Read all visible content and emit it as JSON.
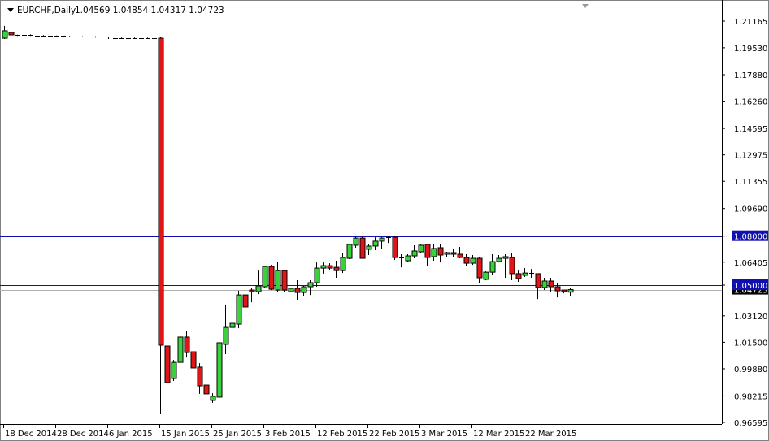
{
  "header": {
    "symbol": "EURCHF,Daily",
    "ohlc": "1.04569 1.04854 1.04317 1.04723"
  },
  "colors": {
    "bull": "#3ad23a",
    "bear": "#e01515",
    "hline": "#1010b0",
    "price_line": "#b0b0b0"
  },
  "chart_data": {
    "type": "candlestick",
    "title": "EURCHF,Daily",
    "ylim": [
      0.96595,
      1.21165
    ],
    "y_ticks": [
      "1.21165",
      "1.19530",
      "1.17880",
      "1.16260",
      "1.14595",
      "1.12975",
      "1.11355",
      "1.09690",
      "1.08000",
      "1.06405",
      "1.05000",
      "1.03120",
      "1.01500",
      "0.99880",
      "0.98215",
      "0.96595"
    ],
    "x_ticks": [
      {
        "index": 0,
        "label": "18 Dec 2014"
      },
      {
        "index": 8,
        "label": "28 Dec 2014"
      },
      {
        "index": 16,
        "label": "6 Jan 2015"
      },
      {
        "index": 24,
        "label": "15 Jan 2015"
      },
      {
        "index": 32,
        "label": "25 Jan 2015"
      },
      {
        "index": 40,
        "label": "3 Feb 2015"
      },
      {
        "index": 48,
        "label": "12 Feb 2015"
      },
      {
        "index": 56,
        "label": "22 Feb 2015"
      },
      {
        "index": 64,
        "label": "3 Mar 2015"
      },
      {
        "index": 72,
        "label": "12 Mar 2015"
      },
      {
        "index": 80,
        "label": "22 Mar 2015"
      }
    ],
    "horizontal_lines": [
      {
        "value": 1.08,
        "label": "1.08000"
      },
      {
        "value": 1.05,
        "label": "1.05000"
      }
    ],
    "last_price": {
      "value": 1.04723,
      "label": "1.04723"
    },
    "ohlc": [
      [
        1.2012,
        1.2087,
        1.2007,
        1.2057
      ],
      [
        1.2047,
        1.2047,
        1.2027,
        1.2032
      ],
      [
        1.203,
        1.2033,
        1.2026,
        1.2029
      ],
      [
        1.2029,
        1.2033,
        1.2025,
        1.203
      ],
      [
        1.203,
        1.2035,
        1.2026,
        1.2028
      ],
      [
        1.2028,
        1.203,
        1.2024,
        1.2027
      ],
      [
        1.2027,
        1.2031,
        1.2023,
        1.2026
      ],
      [
        1.2026,
        1.2028,
        1.2022,
        1.2024
      ],
      [
        1.2024,
        1.2028,
        1.2021,
        1.2025
      ],
      [
        1.2025,
        1.2029,
        1.202,
        1.2023
      ],
      [
        1.2023,
        1.2026,
        1.2019,
        1.2022
      ],
      [
        1.2022,
        1.2025,
        1.2018,
        1.2021
      ],
      [
        1.2021,
        1.2024,
        1.2018,
        1.202
      ],
      [
        1.202,
        1.2023,
        1.2017,
        1.2019
      ],
      [
        1.2019,
        1.2024,
        1.2016,
        1.2021
      ],
      [
        1.2021,
        1.2025,
        1.2017,
        1.202
      ],
      [
        1.202,
        1.2022,
        1.2007,
        1.2012
      ],
      [
        1.2013,
        1.2016,
        1.201,
        1.2014
      ],
      [
        1.2014,
        1.2016,
        1.2011,
        1.2013
      ],
      [
        1.2013,
        1.2016,
        1.201,
        1.2014
      ],
      [
        1.2014,
        1.2016,
        1.2011,
        1.2013
      ],
      [
        1.2013,
        1.2015,
        1.201,
        1.2012
      ],
      [
        1.2012,
        1.2015,
        1.201,
        1.2013
      ],
      [
        1.2013,
        1.2015,
        1.201,
        1.2012
      ],
      [
        1.2012,
        1.2017,
        0.9709,
        1.0132
      ],
      [
        1.0127,
        1.0246,
        0.9744,
        0.9903
      ],
      [
        0.9928,
        1.0042,
        0.9913,
        1.0027
      ],
      [
        1.0027,
        1.0211,
        0.9858,
        1.0182
      ],
      [
        1.0182,
        1.0221,
        1.0057,
        1.0087
      ],
      [
        1.0092,
        1.0132,
        0.9843,
        0.9993
      ],
      [
        0.9998,
        1.0022,
        0.9834,
        0.9883
      ],
      [
        0.9888,
        0.9913,
        0.9774,
        0.9834
      ],
      [
        0.9794,
        0.9838,
        0.9779,
        0.9819
      ],
      [
        0.9814,
        1.0167,
        0.9814,
        1.0147
      ],
      [
        1.0137,
        1.0381,
        1.0077,
        1.0241
      ],
      [
        1.0241,
        1.0316,
        1.0177,
        1.0266
      ],
      [
        1.0261,
        1.0465,
        1.0236,
        1.044
      ],
      [
        1.044,
        1.052,
        1.0346,
        1.0366
      ],
      [
        1.047,
        1.048,
        1.0395,
        1.046
      ],
      [
        1.046,
        1.0589,
        1.0445,
        1.0495
      ],
      [
        1.049,
        1.0619,
        1.048,
        1.0614
      ],
      [
        1.0614,
        1.0624,
        1.047,
        1.0475
      ],
      [
        1.047,
        1.0644,
        1.0455,
        1.0589
      ],
      [
        1.0589,
        1.0594,
        1.0455,
        1.047
      ],
      [
        1.046,
        1.0485,
        1.0455,
        1.048
      ],
      [
        1.048,
        1.053,
        1.041,
        1.0455
      ],
      [
        1.0455,
        1.0495,
        1.0435,
        1.049
      ],
      [
        1.049,
        1.053,
        1.044,
        1.0515
      ],
      [
        1.0515,
        1.0639,
        1.049,
        1.0604
      ],
      [
        1.0604,
        1.0639,
        1.057,
        1.0619
      ],
      [
        1.0619,
        1.0634,
        1.0594,
        1.0604
      ],
      [
        1.0609,
        1.0649,
        1.0545,
        1.0589
      ],
      [
        1.0589,
        1.0694,
        1.0574,
        1.0669
      ],
      [
        1.0664,
        1.0754,
        1.0659,
        1.0749
      ],
      [
        1.0744,
        1.0803,
        1.0729,
        1.0788
      ],
      [
        1.0788,
        1.0803,
        1.0664,
        1.0664
      ],
      [
        1.0719,
        1.0754,
        1.0684,
        1.0739
      ],
      [
        1.0739,
        1.0793,
        1.0714,
        1.0769
      ],
      [
        1.0769,
        1.0793,
        1.0724,
        1.0788
      ],
      [
        1.0788,
        1.0798,
        1.0758,
        1.0793
      ],
      [
        1.0793,
        1.0798,
        1.0654,
        1.0669
      ],
      [
        1.0669,
        1.0689,
        1.0609,
        1.0664
      ],
      [
        1.0649,
        1.0689,
        1.0644,
        1.0679
      ],
      [
        1.0679,
        1.0744,
        1.0664,
        1.0709
      ],
      [
        1.0704,
        1.0754,
        1.0699,
        1.0744
      ],
      [
        1.0749,
        1.0754,
        1.0619,
        1.0669
      ],
      [
        1.0674,
        1.0749,
        1.0649,
        1.0724
      ],
      [
        1.0729,
        1.0754,
        1.0639,
        1.0684
      ],
      [
        1.0689,
        1.0704,
        1.0674,
        1.0699
      ],
      [
        1.0699,
        1.0719,
        1.0674,
        1.0689
      ],
      [
        1.0689,
        1.0734,
        1.0664,
        1.0669
      ],
      [
        1.0669,
        1.0689,
        1.0619,
        1.0634
      ],
      [
        1.0634,
        1.0684,
        1.0624,
        1.0664
      ],
      [
        1.0664,
        1.0674,
        1.0515,
        1.0545
      ],
      [
        1.0535,
        1.0584,
        1.053,
        1.0579
      ],
      [
        1.0579,
        1.0689,
        1.0565,
        1.0644
      ],
      [
        1.0644,
        1.0684,
        1.0639,
        1.0664
      ],
      [
        1.0664,
        1.0689,
        1.0545,
        1.0674
      ],
      [
        1.0669,
        1.0699,
        1.053,
        1.057
      ],
      [
        1.057,
        1.0589,
        1.052,
        1.054
      ],
      [
        1.056,
        1.0604,
        1.055,
        1.0574
      ],
      [
        1.0574,
        1.0599,
        1.0545,
        1.057
      ],
      [
        1.057,
        1.057,
        1.0415,
        1.0485
      ],
      [
        1.0485,
        1.0545,
        1.047,
        1.0525
      ],
      [
        1.0525,
        1.0545,
        1.046,
        1.049
      ],
      [
        1.049,
        1.051,
        1.0425,
        1.0465
      ],
      [
        1.047,
        1.047,
        1.045,
        1.046
      ],
      [
        1.04569,
        1.04854,
        1.04317,
        1.04723
      ]
    ]
  }
}
